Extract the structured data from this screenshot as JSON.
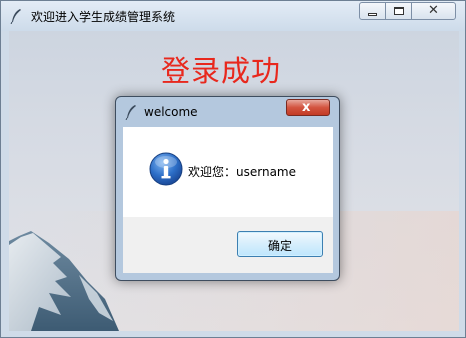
{
  "window": {
    "title": "欢迎进入学生成绩管理系统",
    "icon": "feather-icon",
    "controls": {
      "minimize": "minimize-icon",
      "maximize": "maximize-icon",
      "close": "✕"
    }
  },
  "main": {
    "headline": "登录成功",
    "headline_color": "#e8281d"
  },
  "dialog": {
    "title": "welcome",
    "close_glyph": "x",
    "icon": "info-icon",
    "message": "欢迎您：username",
    "ok_label": "确定",
    "close_color": "#c7402b",
    "button_border_color": "#3c7fb1"
  }
}
